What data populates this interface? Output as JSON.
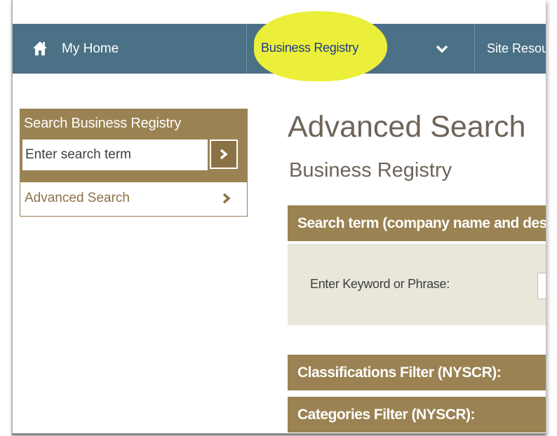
{
  "nav": {
    "home_label": "My Home",
    "business_label": "Business Registry",
    "site_label": "Site Resources",
    "highlight_color": "#ecef3a",
    "bar_color": "#4a7186"
  },
  "sidebar": {
    "title": "Search Business Registry",
    "search_placeholder": "Enter search term",
    "advanced_label": "Advanced Search",
    "accent_color": "#9a8252"
  },
  "main": {
    "title": "Advanced Search",
    "subtitle": "Business Registry",
    "search_section": {
      "heading": "Search term (company name and description)",
      "keyword_label": "Enter Keyword or Phrase:",
      "keyword_value": ""
    },
    "classifications_heading": "Classifications Filter (NYSCR):",
    "categories_heading": "Categories Filter (NYSCR):"
  }
}
